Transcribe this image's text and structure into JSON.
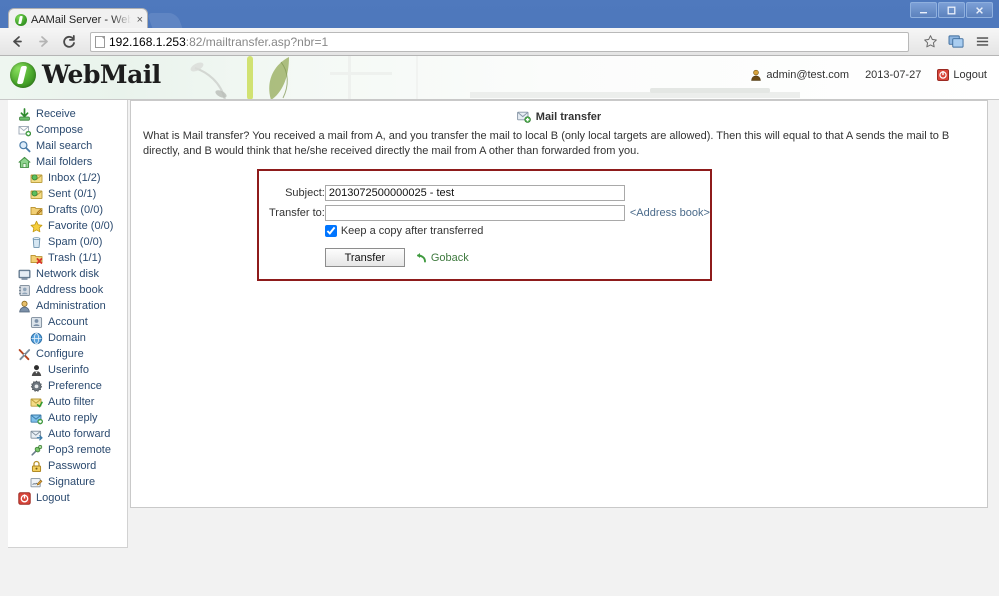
{
  "window": {
    "minimize_label": "Minimize",
    "maximize_label": "Maximize",
    "close_label": "Close"
  },
  "browser": {
    "tab_title": "AAMail Server - Webma",
    "tab_close_label": "×",
    "back_label": "←",
    "forward_label": "→",
    "reload_label": "C",
    "url_main": "192.168.1.253",
    "url_rest": ":82/mailtransfer.asp?nbr=1",
    "bookmark_icon": "star-icon",
    "extension_icon": "window-icon",
    "menu_icon": "hamburger-menu-icon"
  },
  "header": {
    "logo_text": "WebMail",
    "user_email": "admin@test.com",
    "date": "2013-07-27",
    "logout_label": "Logout"
  },
  "sidebar": {
    "items": [
      {
        "label": "Receive",
        "icon": "receive-icon",
        "sub": false
      },
      {
        "label": "Compose",
        "icon": "compose-icon",
        "sub": false
      },
      {
        "label": "Mail search",
        "icon": "search-icon",
        "sub": false
      },
      {
        "label": "Mail folders",
        "icon": "folders-home-icon",
        "sub": false
      },
      {
        "label": "Inbox (1/2)",
        "icon": "inbox-icon",
        "sub": true
      },
      {
        "label": "Sent (0/1)",
        "icon": "sent-icon",
        "sub": true
      },
      {
        "label": "Drafts (0/0)",
        "icon": "drafts-icon",
        "sub": true
      },
      {
        "label": "Favorite (0/0)",
        "icon": "star-icon",
        "sub": true
      },
      {
        "label": "Spam (0/0)",
        "icon": "spam-icon",
        "sub": true
      },
      {
        "label": "Trash (1/1)",
        "icon": "trash-icon",
        "sub": true
      },
      {
        "label": "Network disk",
        "icon": "network-disk-icon",
        "sub": false
      },
      {
        "label": "Address book",
        "icon": "address-book-icon",
        "sub": false
      },
      {
        "label": "Administration",
        "icon": "administration-icon",
        "sub": false
      },
      {
        "label": "Account",
        "icon": "account-icon",
        "sub": true
      },
      {
        "label": "Domain",
        "icon": "domain-globe-icon",
        "sub": true
      },
      {
        "label": "Configure",
        "icon": "configure-tools-icon",
        "sub": false
      },
      {
        "label": "Userinfo",
        "icon": "userinfo-icon",
        "sub": true
      },
      {
        "label": "Preference",
        "icon": "gear-icon",
        "sub": true
      },
      {
        "label": "Auto filter",
        "icon": "auto-filter-icon",
        "sub": true
      },
      {
        "label": "Auto reply",
        "icon": "auto-reply-icon",
        "sub": true
      },
      {
        "label": "Auto forward",
        "icon": "auto-forward-icon",
        "sub": true
      },
      {
        "label": "Pop3 remote",
        "icon": "pop3-remote-icon",
        "sub": true
      },
      {
        "label": "Password",
        "icon": "lock-icon",
        "sub": true
      },
      {
        "label": "Signature",
        "icon": "signature-icon",
        "sub": true
      },
      {
        "label": "Logout",
        "icon": "logout-icon",
        "sub": false
      }
    ]
  },
  "main": {
    "panel_title": "Mail transfer",
    "panel_title_icon": "mail-transfer-icon",
    "description": "What is Mail transfer? You received a mail from A, and you transfer the mail to local B (only local targets are allowed). Then this will equal to that A sends the mail to B directly, and B would think that he/she received directly the mail from A other than forwarded from you.",
    "form": {
      "subject_label": "Subject:",
      "subject_value": "2013072500000025 - test",
      "transfer_to_label": "Transfer to:",
      "transfer_to_value": "",
      "transfer_to_placeholder": "",
      "address_book_label": "<Address book>",
      "keep_copy_label": "Keep a copy after transferred",
      "keep_copy_checked": true,
      "submit_label": "Transfer",
      "goback_label": "Goback"
    }
  },
  "colors": {
    "accent_red": "#8e1b1b",
    "link_blue": "#2b4a6f",
    "green": "#3f7a3f",
    "window_blue": "#3e67ae"
  }
}
